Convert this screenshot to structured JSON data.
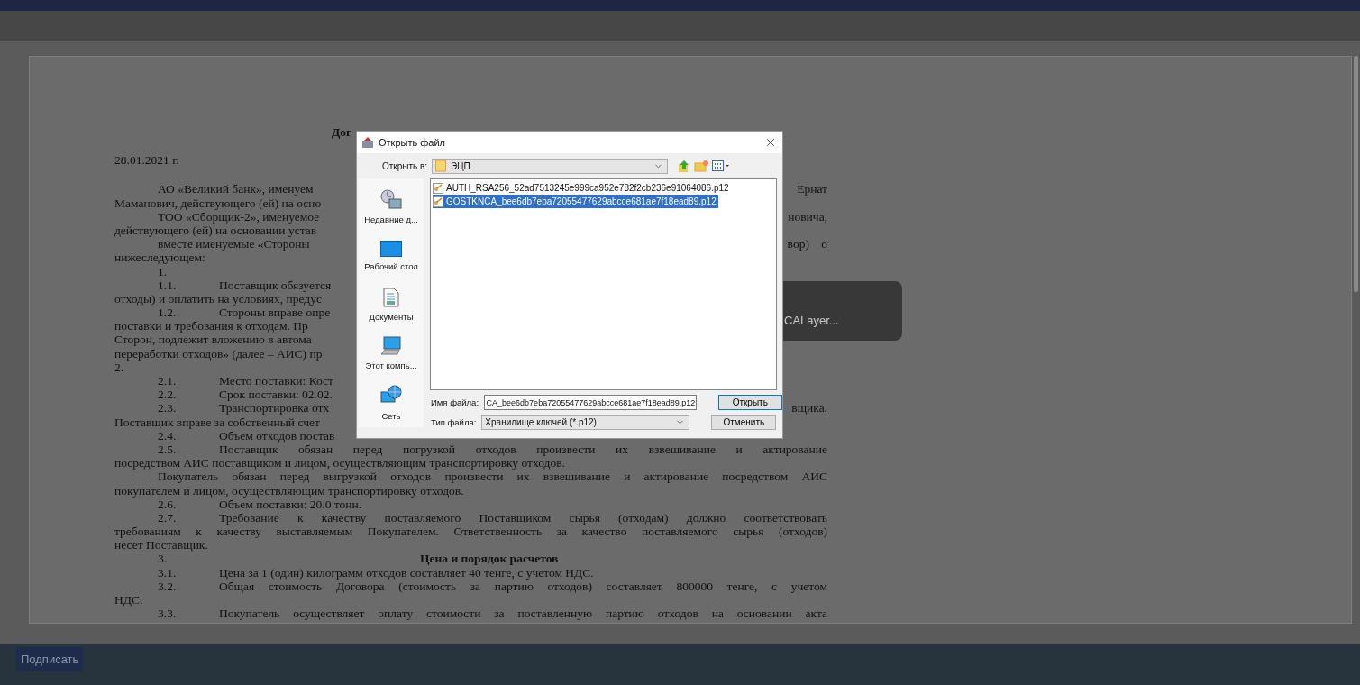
{
  "document": {
    "title": "Дог",
    "date": "28.01.2021 г.",
    "lines": [
      {
        "kind": "indent",
        "text": "АО «Великий банк», именуем",
        "right": "Ернат"
      },
      {
        "kind": "plain",
        "text": "Маманович, действующего (ей) на осно"
      },
      {
        "kind": "indent",
        "text": "ТОО «Сборщик-2», именуемое",
        "right": "новича,"
      },
      {
        "kind": "plain",
        "text": "действующего (ей) на основании устав"
      },
      {
        "kind": "indent",
        "text": "вместе именуемые «Стороны",
        "right": "вор) о"
      },
      {
        "kind": "plain",
        "text": "нижеследующем:"
      },
      {
        "kind": "indent",
        "text": "1."
      },
      {
        "kind": "numbered",
        "number": "1.1.",
        "text": "Поставщик обязуется"
      },
      {
        "kind": "plain",
        "text": "отходы) и оплатить на условиях, предус"
      },
      {
        "kind": "numbered",
        "number": "1.2.",
        "text": "Стороны вправе опре"
      },
      {
        "kind": "plain",
        "text": "поставки и требования к отходам. Пр"
      },
      {
        "kind": "plain",
        "text": "Сторон, подлежит вложению в автома"
      },
      {
        "kind": "plain",
        "text": "переработки отходов» (далее – АИС) пр"
      },
      {
        "kind": "plain",
        "text": "2."
      },
      {
        "kind": "numbered",
        "number": "2.1.",
        "text": "Место поставки: Кост"
      },
      {
        "kind": "numbered",
        "number": "2.2.",
        "text": "Срок поставки: 02.02."
      },
      {
        "kind": "numbered",
        "number": "2.3.",
        "text": "Транспортировка отх",
        "right": "вщика."
      },
      {
        "kind": "plain",
        "text": "Поставщик вправе за собственный счет"
      },
      {
        "kind": "numbered",
        "number": "2.4.",
        "text": "Объем отходов постав"
      },
      {
        "kind": "numbered",
        "number": "2.5.",
        "text": "Поставщик обязан перед погрузкой отходов произвести их взвешивание и актирование",
        "justified": true
      },
      {
        "kind": "plain",
        "text": "посредством АИС поставщиком и лицом, осуществляющим транспортировку отходов.",
        "justified": false
      },
      {
        "kind": "indent",
        "text": "Покупатель обязан перед выгрузкой отходов произвести их взвешивание и актирование посредством АИС",
        "justified": true
      },
      {
        "kind": "plain",
        "text": "покупателем и лицом, осуществляющим транспортировку отходов.",
        "justified": false
      },
      {
        "kind": "numbered",
        "number": "2.6.",
        "text": "Объем поставки: 20.0 тонн.",
        "justified": false
      },
      {
        "kind": "numbered",
        "number": "2.7.",
        "text": "Требование к качеству поставляемого Поставщиком сырья (отходам) должно соответствовать",
        "justified": true
      },
      {
        "kind": "plain",
        "text": "требованиям к качеству выставляемым Покупателем. Ответственность за качество поставляемого сырья (отходов)",
        "justified": true
      },
      {
        "kind": "plain",
        "text": "несет Поставщик.",
        "justified": false
      },
      {
        "kind": "heading",
        "number": "3.",
        "text": "Цена и порядок расчетов"
      },
      {
        "kind": "numbered",
        "number": "3.1.",
        "text": "Цена за 1 (один) килограмм отходов составляет 40 тенге, с учетом НДС.",
        "justified": false
      },
      {
        "kind": "numbered",
        "number": "3.2.",
        "text": "Общая стоимость Договора (стоимость за партию отходов) составляет 800000 тенге, с учетом",
        "justified": true
      },
      {
        "kind": "plain",
        "text": "НДС."
      },
      {
        "kind": "numbered",
        "number": "3.3.",
        "text": "Покупатель осуществляет оплату стоимости за поставленную партию отходов на основании акта",
        "justified": true
      }
    ]
  },
  "dialog": {
    "title": "Открыть файл",
    "look_in_label": "Открыть в:",
    "look_in_value": "ЭЦП",
    "places": [
      {
        "kind": "recent",
        "label": "Недавние д..."
      },
      {
        "kind": "desktop",
        "label": "Рабочий стол"
      },
      {
        "kind": "documents",
        "label": "Документы"
      },
      {
        "kind": "computer",
        "label": "Этот компь..."
      },
      {
        "kind": "network",
        "label": "Сеть"
      }
    ],
    "files": [
      {
        "name": "AUTH_RSA256_52ad7513245e999ca952e782f2cb236e91064086.p12",
        "selected": false
      },
      {
        "name": "GOSTKNCA_bee6db7eba72055477629abcce681ae7f18ead89.p12",
        "selected": true
      }
    ],
    "file_name_label": "Имя файла:",
    "file_name_value": "CA_bee6db7eba72055477629abcce681ae7f18ead89.p12",
    "file_type_label": "Тип файла:",
    "file_type_value": "Хранилище ключей (*.p12)",
    "buttons": [
      {
        "label": "Открыть",
        "default": true
      },
      {
        "label": "Отменить",
        "default": false
      }
    ]
  },
  "toast": {
    "text": "CALayer..."
  },
  "sign_button": "Подписать"
}
